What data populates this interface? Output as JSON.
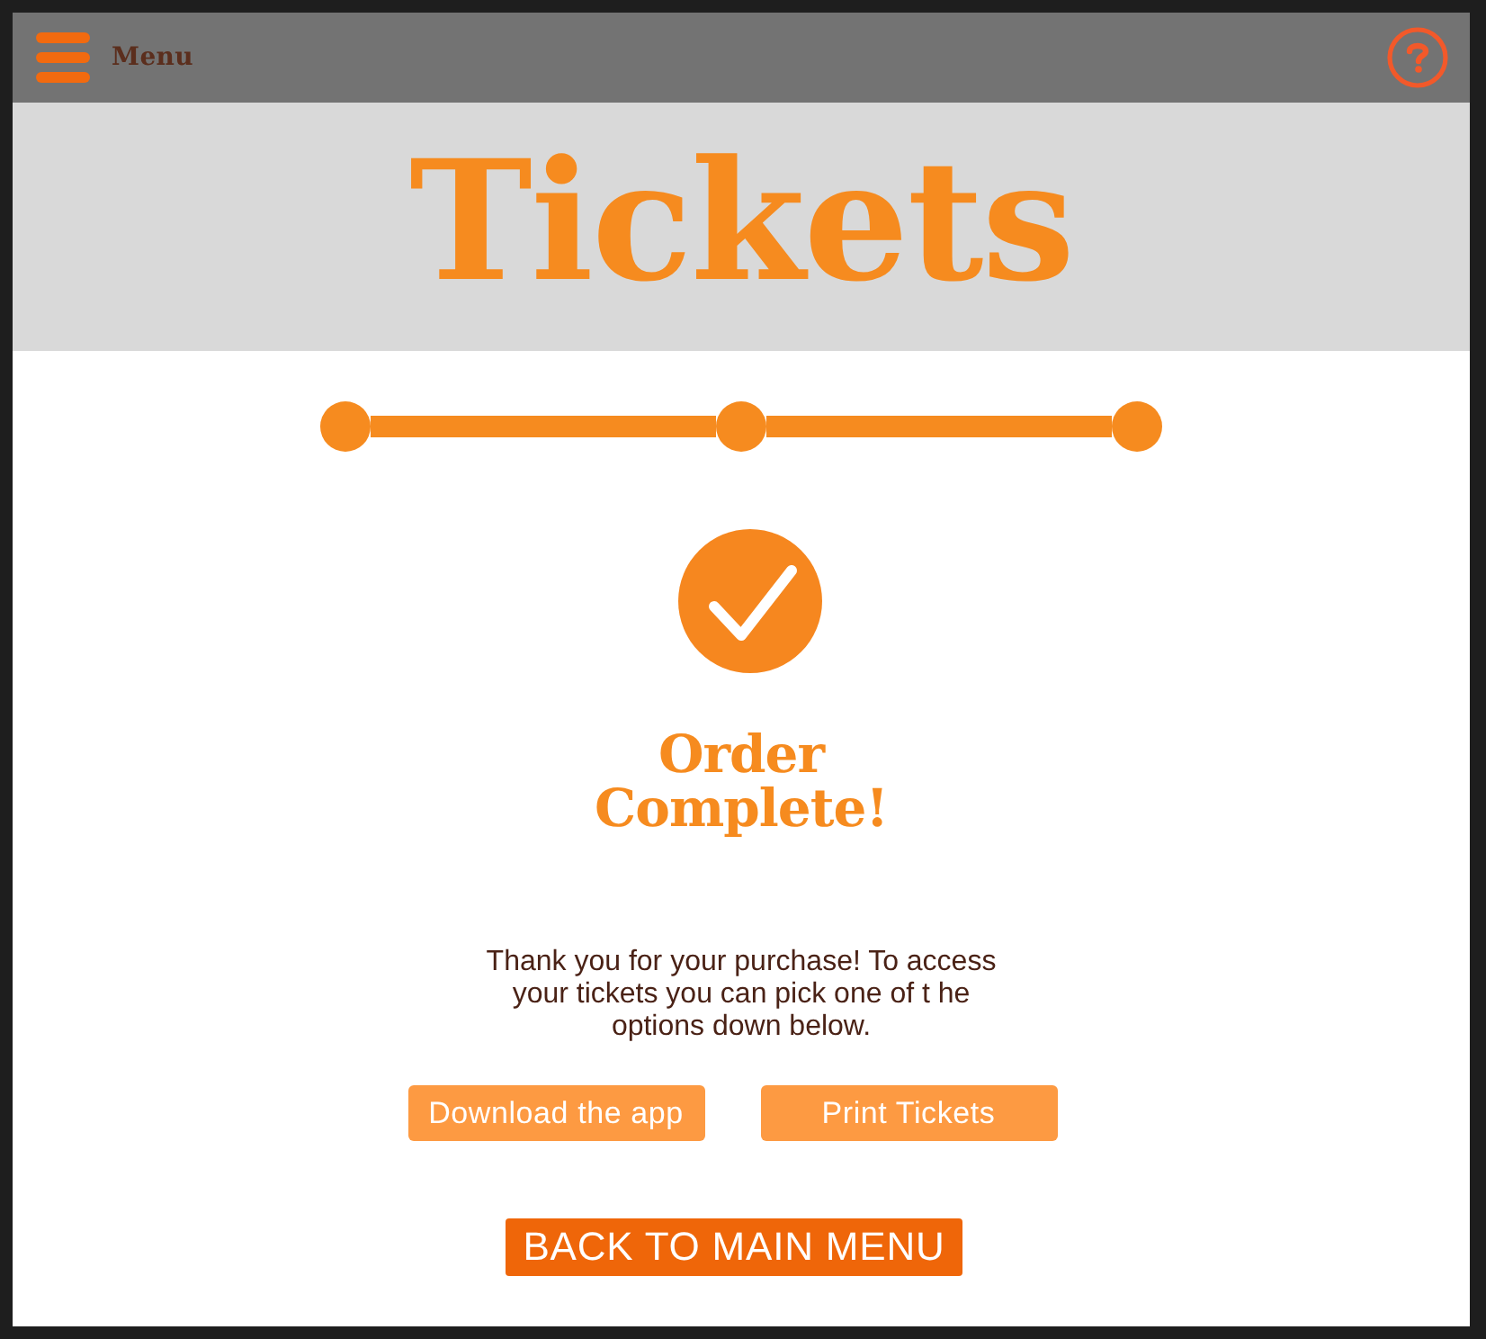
{
  "top_bar": {
    "menu_label": "Menu"
  },
  "header": {
    "title": "Tickets"
  },
  "progress": {
    "steps": [
      {
        "completed": true
      },
      {
        "completed": true
      },
      {
        "completed": true
      }
    ]
  },
  "status": {
    "title": "Order Complete!",
    "message_lines": [
      "Thank you for your purchase! To access",
      "your tickets you can pick one of t he",
      "options down below."
    ]
  },
  "actions": [
    {
      "label": "Download the app"
    },
    {
      "label": "Print Tickets"
    }
  ],
  "back_button": {
    "label": "BACK TO MAIN MENU"
  }
}
